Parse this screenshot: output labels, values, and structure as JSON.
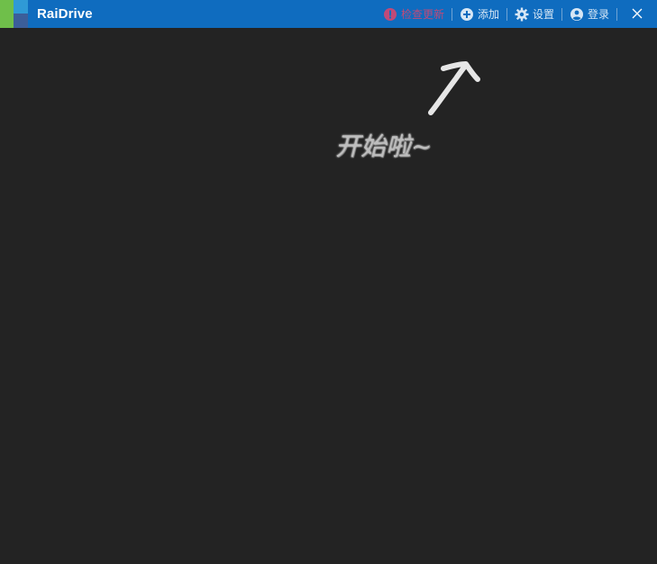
{
  "app": {
    "title": "RaiDrive"
  },
  "toolbar": {
    "warning_label": "检查更新",
    "add_label": "添加",
    "settings_label": "设置",
    "login_label": "登录"
  },
  "content": {
    "hint_text": "开始啦~"
  },
  "colors": {
    "titlebar": "#0f6cbf",
    "background": "#232323",
    "toolbar_text": "#d6e6f5",
    "warning": "#c04a78"
  }
}
